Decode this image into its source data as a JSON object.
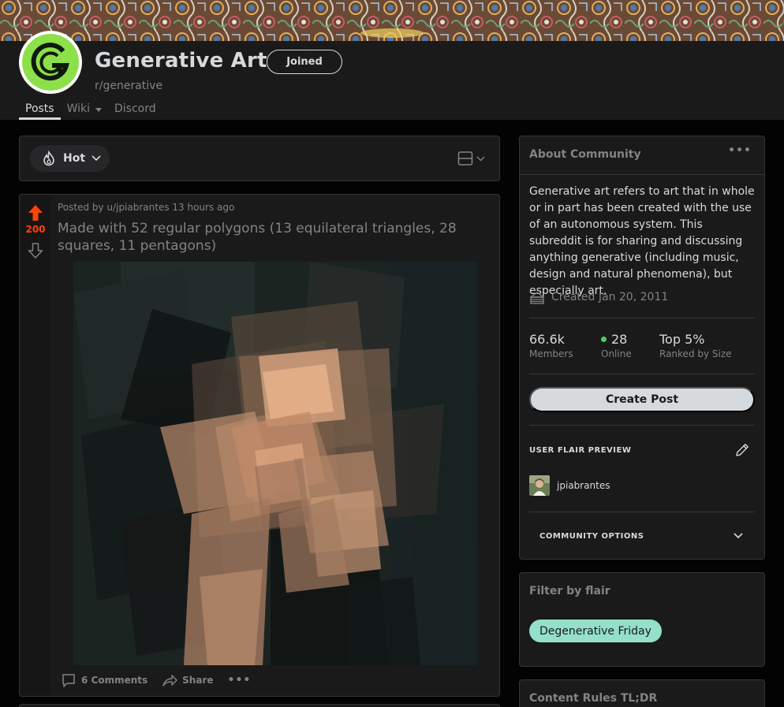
{
  "community": {
    "title": "Generative Art",
    "name": "r/generative",
    "join_state": "Joined",
    "tabs": [
      {
        "label": "Posts",
        "active": true
      },
      {
        "label": "Wiki",
        "has_dropdown": true
      },
      {
        "label": "Discord"
      }
    ]
  },
  "sort": {
    "label": "Hot",
    "icon": "flame-icon",
    "layout_icon": "card-layout-icon"
  },
  "post": {
    "score": "200",
    "meta": "Posted by u/jpiabrantes 13 hours ago",
    "title": "Made with 52 regular polygons (13 equilateral triangles, 28 squares, 11 pentagons)",
    "comments_label": "6 Comments",
    "share_label": "Share",
    "more_label": "•••"
  },
  "about": {
    "heading": "About Community",
    "more_label": "•••",
    "description": "Generative art refers to art that in whole or in part has been created with the use of an autonomous system. This subreddit is for sharing and discussing anything generative (including music, design and natural phenomena), but especially art.",
    "created": "Created Jan 20, 2011",
    "stats": [
      {
        "value": "66.6k",
        "label": "Members"
      },
      {
        "value": "28",
        "label": "Online"
      },
      {
        "value": "Top 5%",
        "label": "Ranked by Size"
      }
    ],
    "create_post_label": "Create Post",
    "flair_preview_heading": "USER FLAIR PREVIEW",
    "username": "jpiabrantes",
    "community_options_label": "COMMUNITY OPTIONS"
  },
  "filter": {
    "heading": "Filter by flair",
    "flairs": [
      "Degenerative Friday"
    ]
  },
  "rules": {
    "heading": "Content Rules TL;DR"
  },
  "colors": {
    "background": "#030303",
    "card": "#1a1a1b",
    "upvote": "#ff4500",
    "logo_green": "#8ce04a",
    "flair": "#94e0c9",
    "online": "#46d160"
  }
}
